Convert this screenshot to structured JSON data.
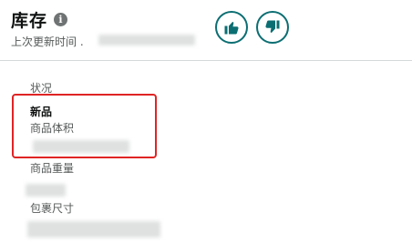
{
  "header": {
    "title": "库存",
    "info_icon_glyph": "i",
    "updated_label": "上次更新时间 ."
  },
  "actions": {
    "thumbs_up_icon": "thumbs-up-icon",
    "thumbs_down_icon": "thumbs-down-icon",
    "accent_color": "#0b6e72"
  },
  "details": {
    "condition_label": "状况",
    "condition_value": "新品",
    "product_volume_label": "商品体积",
    "product_weight_label": "商品重量",
    "package_size_label": "包裹尺寸"
  },
  "highlight_color": "#e02424"
}
